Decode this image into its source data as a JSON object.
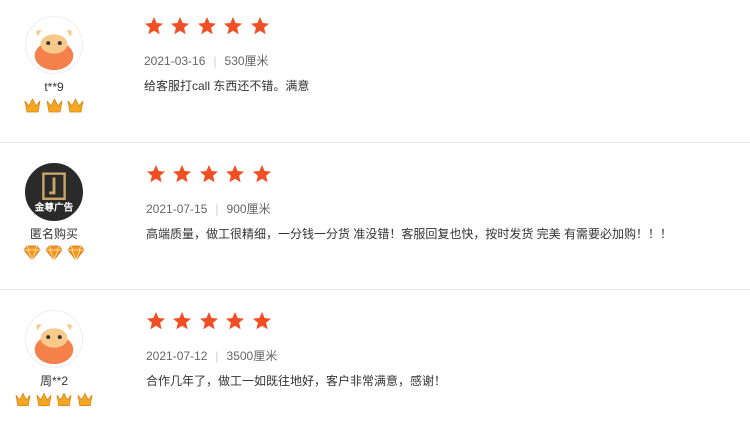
{
  "colors": {
    "star": "#f04e23",
    "level_crown": "#f5a623",
    "diamond": "#f7941d"
  },
  "reviews": [
    {
      "user": "t**9",
      "avatar_icon": "cow-avatar-icon",
      "level_icon": "crown-icon",
      "level_count": 3,
      "rating": 5,
      "date": "2021-03-16",
      "height": "530厘米",
      "text": "给客服打call 东西还不错。满意"
    },
    {
      "user": "匿名购买",
      "avatar_icon": "shop-logo-avatar",
      "avatar_text": "金尊广告",
      "level_icon": "diamond-icon",
      "level_count": 3,
      "rating": 5,
      "date": "2021-07-15",
      "height": "900厘米",
      "text": "高端质量，做工很精细，一分钱一分货 准没错！客服回复也快，按时发货 完美 有需要必加购！！！"
    },
    {
      "user": "周**2",
      "avatar_icon": "cow-avatar-icon",
      "level_icon": "crown-icon",
      "level_count": 4,
      "rating": 5,
      "date": "2021-07-12",
      "height": "3500厘米",
      "text": "合作几年了，做工一如既往地好，客户非常满意，感谢！"
    }
  ]
}
